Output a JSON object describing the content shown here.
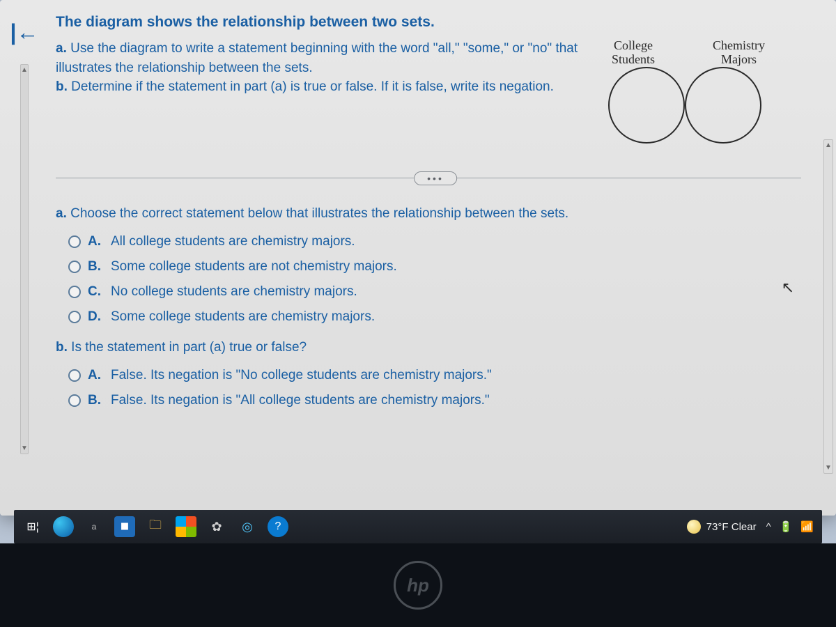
{
  "intro": "The diagram shows the relationship between two sets.",
  "instructions": {
    "a_prefix": "a.",
    "a_text": "Use the diagram to write a statement beginning with the word \"all,\" \"some,\" or \"no\" that illustrates the relationship between the sets.",
    "b_prefix": "b.",
    "b_text": "Determine if the statement in part (a) is true or false. If it is false, write its negation."
  },
  "venn": {
    "label_left": "College\nStudents",
    "label_right": "Chemistry\nMajors"
  },
  "ellipsis": "•••",
  "question_a": {
    "tag": "a.",
    "prompt": "Choose the correct statement below that illustrates the relationship between the sets.",
    "options": [
      {
        "letter": "A.",
        "text": "All college students are chemistry majors."
      },
      {
        "letter": "B.",
        "text": "Some college students are not chemistry majors."
      },
      {
        "letter": "C.",
        "text": "No college students are chemistry majors."
      },
      {
        "letter": "D.",
        "text": "Some college students are chemistry majors."
      }
    ]
  },
  "question_b": {
    "tag": "b.",
    "prompt": "Is the statement in part (a) true or false?",
    "options": [
      {
        "letter": "A.",
        "text": "False. Its negation is \"No college students are chemistry majors.\""
      },
      {
        "letter": "B.",
        "text": "False. Its negation is \"All college students are chemistry majors.\""
      }
    ]
  },
  "taskbar": {
    "weather": "73°F  Clear",
    "tray_caret": "^"
  },
  "bezel": {
    "logo": "hp"
  }
}
